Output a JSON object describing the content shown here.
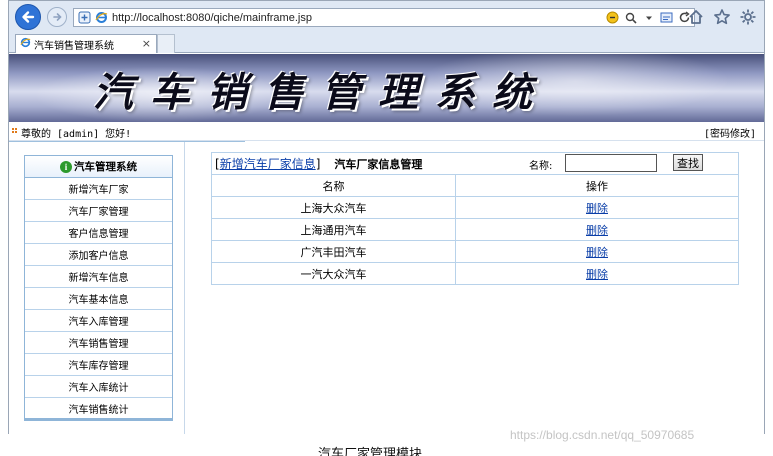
{
  "browser": {
    "url": "http://localhost:8080/qiche/mainframe.jsp",
    "tab_title": "汽车销售管理系统",
    "tab_close": "×"
  },
  "page": {
    "banner_title": "汽车销售管理系统",
    "welcome_text": "尊敬的 [admin] 您好!",
    "password_link": "[密码修改]"
  },
  "sidebar": {
    "header": "汽车管理系统",
    "items": [
      {
        "label": "新增汽车厂家"
      },
      {
        "label": "汽车厂家管理"
      },
      {
        "label": "客户信息管理"
      },
      {
        "label": "添加客户信息"
      },
      {
        "label": "新增汽车信息"
      },
      {
        "label": "汽车基本信息"
      },
      {
        "label": "汽车入库管理"
      },
      {
        "label": "汽车销售管理"
      },
      {
        "label": "汽车库存管理"
      },
      {
        "label": "汽车入库统计"
      },
      {
        "label": "汽车销售统计"
      }
    ]
  },
  "main": {
    "bracket_open": "[",
    "add_link": "新增汽车厂家信息",
    "bracket_close": "]",
    "module_title": "汽车厂家信息管理",
    "search_label": "名称:",
    "search_value": "",
    "search_button": "查找",
    "table": {
      "headers": [
        "名称",
        "操作"
      ],
      "rows": [
        {
          "name": "上海大众汽车",
          "action": "删除"
        },
        {
          "name": "上海通用汽车",
          "action": "删除"
        },
        {
          "name": "广汽丰田汽车",
          "action": "删除"
        },
        {
          "name": "一汽大众汽车",
          "action": "删除"
        }
      ]
    }
  },
  "overlay": {
    "watermark": "https://blog.csdn.net/qq_50970685",
    "caption": "汽车厂家管理模块"
  },
  "colors": {
    "link": "#0a3ea8",
    "border": "#b8d2ea",
    "back_button": "#2f73d6"
  }
}
